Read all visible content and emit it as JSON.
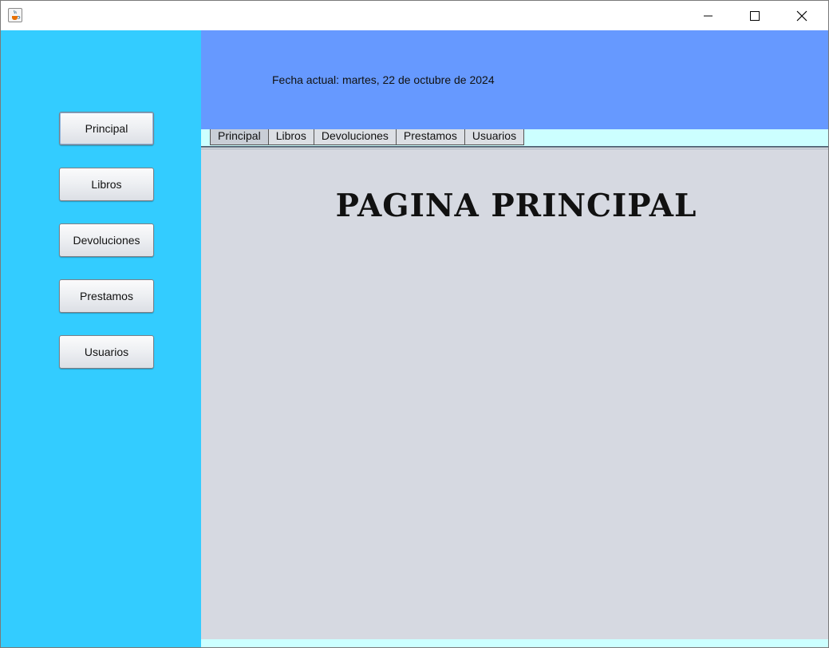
{
  "window": {
    "icon": "java-cup-icon",
    "controls": [
      "minimize-icon",
      "maximize-icon",
      "close-icon"
    ]
  },
  "sidebar": {
    "background": "#33ccff",
    "buttons": [
      {
        "label": "Principal"
      },
      {
        "label": "Libros"
      },
      {
        "label": "Devoluciones"
      },
      {
        "label": "Prestamos"
      },
      {
        "label": "Usuarios"
      }
    ]
  },
  "header": {
    "background": "#6699ff",
    "date_text": "Fecha actual: martes, 22 de octubre de 2024"
  },
  "tabs": {
    "selected": "Principal",
    "items": [
      {
        "label": "Principal"
      },
      {
        "label": "Libros"
      },
      {
        "label": "Devoluciones"
      },
      {
        "label": "Prestamos"
      },
      {
        "label": "Usuarios"
      }
    ]
  },
  "main": {
    "title": "PAGINA PRINCIPAL",
    "background": "#d6d9e1"
  }
}
